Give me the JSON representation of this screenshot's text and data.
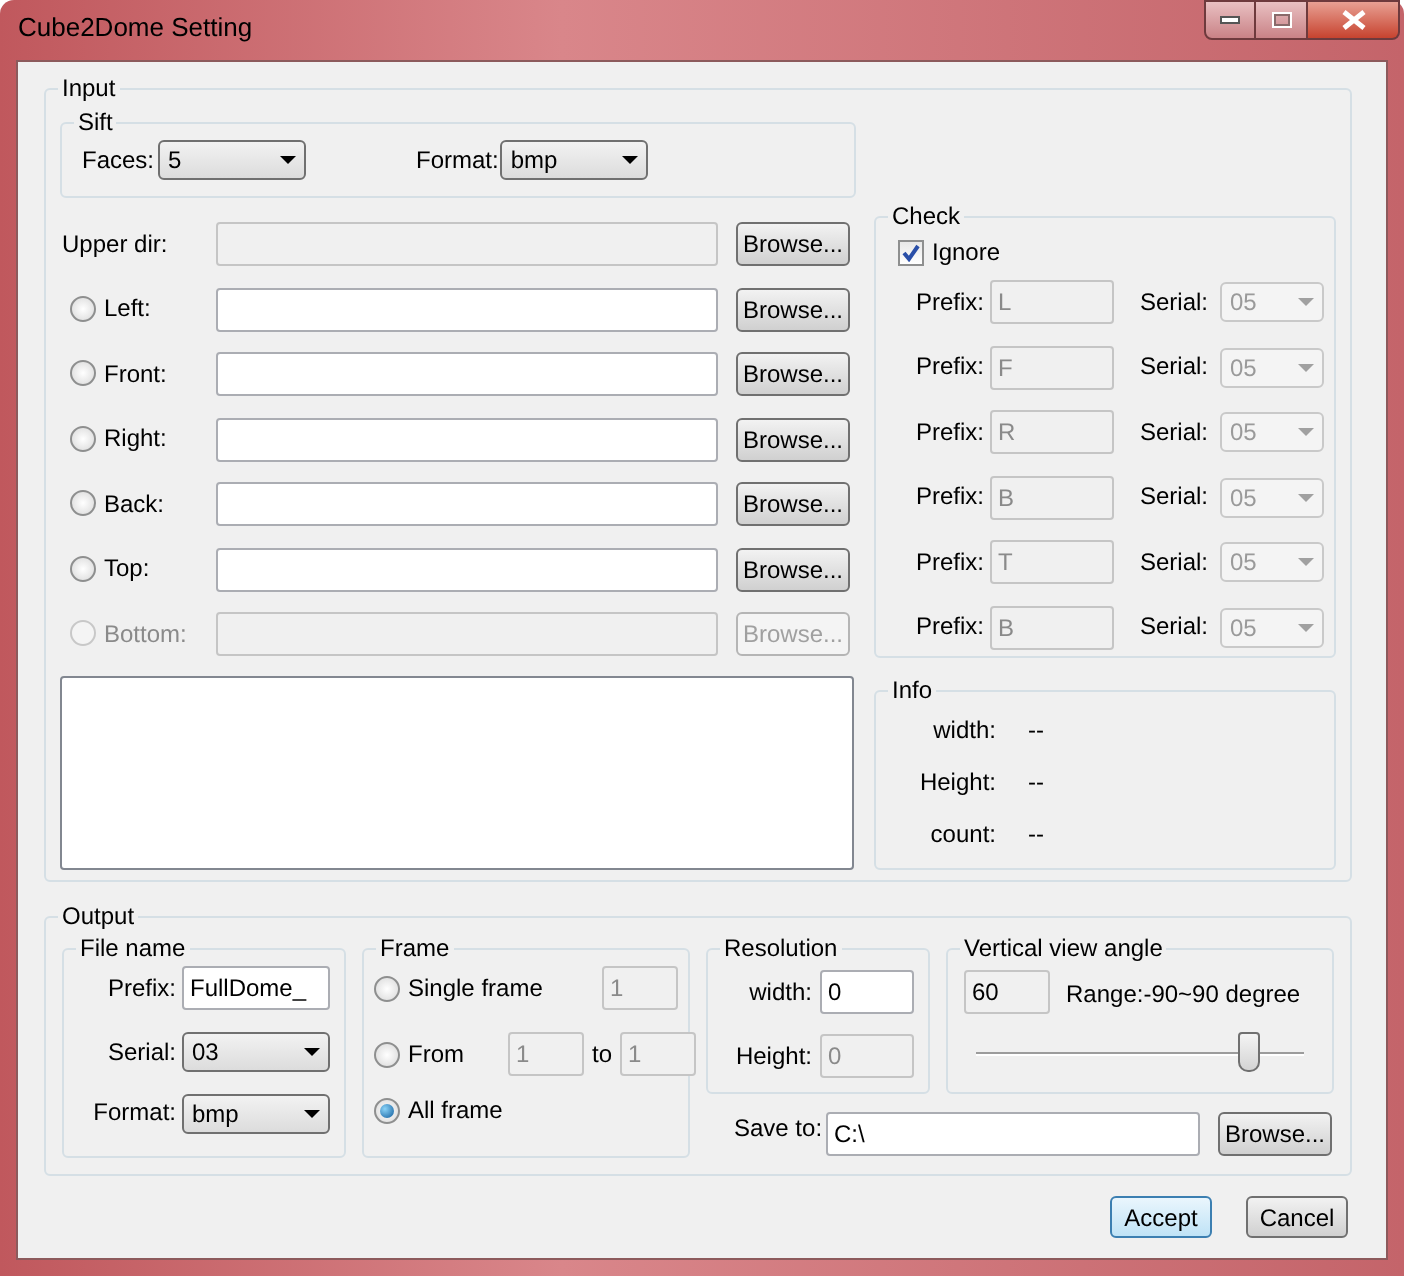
{
  "window": {
    "title": "Cube2Dome Setting"
  },
  "input": {
    "legend": "Input",
    "sift": {
      "legend": "Sift",
      "faces": {
        "label": "Faces:",
        "value": "5"
      },
      "format": {
        "label": "Format:",
        "value": "bmp"
      }
    },
    "upper_dir": {
      "label": "Upper dir:",
      "disabled": true,
      "button": "Browse..."
    },
    "faces": [
      {
        "label": "Left:",
        "selected": false,
        "disabled": false,
        "button": "Browse..."
      },
      {
        "label": "Front:",
        "selected": false,
        "disabled": false,
        "button": "Browse..."
      },
      {
        "label": "Right:",
        "selected": false,
        "disabled": false,
        "button": "Browse..."
      },
      {
        "label": "Back:",
        "selected": false,
        "disabled": false,
        "button": "Browse..."
      },
      {
        "label": "Top:",
        "selected": false,
        "disabled": false,
        "button": "Browse..."
      },
      {
        "label": "Bottom:",
        "selected": false,
        "disabled": true,
        "button": "Browse..."
      }
    ],
    "check": {
      "legend": "Check",
      "ignore": {
        "label": "Ignore",
        "checked": true
      },
      "rows": [
        {
          "prefix_label": "Prefix:",
          "prefix": "L",
          "serial_label": "Serial:",
          "serial": "05",
          "disabled": true
        },
        {
          "prefix_label": "Prefix:",
          "prefix": "F",
          "serial_label": "Serial:",
          "serial": "05",
          "disabled": true
        },
        {
          "prefix_label": "Prefix:",
          "prefix": "R",
          "serial_label": "Serial:",
          "serial": "05",
          "disabled": true
        },
        {
          "prefix_label": "Prefix:",
          "prefix": "B",
          "serial_label": "Serial:",
          "serial": "05",
          "disabled": true
        },
        {
          "prefix_label": "Prefix:",
          "prefix": "T",
          "serial_label": "Serial:",
          "serial": "05",
          "disabled": true
        },
        {
          "prefix_label": "Prefix:",
          "prefix": "B",
          "serial_label": "Serial:",
          "serial": "05",
          "disabled": true
        }
      ]
    },
    "info": {
      "legend": "Info",
      "rows": [
        {
          "label": "width:",
          "value": "--"
        },
        {
          "label": "Height:",
          "value": "--"
        },
        {
          "label": "count:",
          "value": "--"
        }
      ]
    }
  },
  "output": {
    "legend": "Output",
    "file_name": {
      "legend": "File name",
      "prefix": {
        "label": "Prefix:",
        "value": "FullDome_"
      },
      "serial": {
        "label": "Serial:",
        "value": "03"
      },
      "format": {
        "label": "Format:",
        "value": "bmp"
      }
    },
    "frame": {
      "legend": "Frame",
      "options": [
        {
          "kind": "single",
          "label": "Single frame",
          "selected": false,
          "value": "1"
        },
        {
          "kind": "range",
          "label": "From",
          "selected": false,
          "from": "1",
          "to_label": "to",
          "to": "1"
        },
        {
          "kind": "plain",
          "label": "All frame",
          "selected": true
        }
      ]
    },
    "resolution": {
      "legend": "Resolution",
      "width": {
        "label": "width:",
        "value": "0",
        "disabled": false
      },
      "height": {
        "label": "Height:",
        "value": "0",
        "disabled": true
      }
    },
    "view_angle": {
      "legend": "Vertical view angle",
      "value": "60",
      "range": "Range:-90~90 degree",
      "level": 0.83
    },
    "save_to": {
      "label": "Save to:",
      "value": "C:\\",
      "button": "Browse..."
    }
  },
  "buttons": [
    {
      "label": "Accept",
      "default": true
    },
    {
      "label": "Cancel",
      "default": false
    }
  ]
}
